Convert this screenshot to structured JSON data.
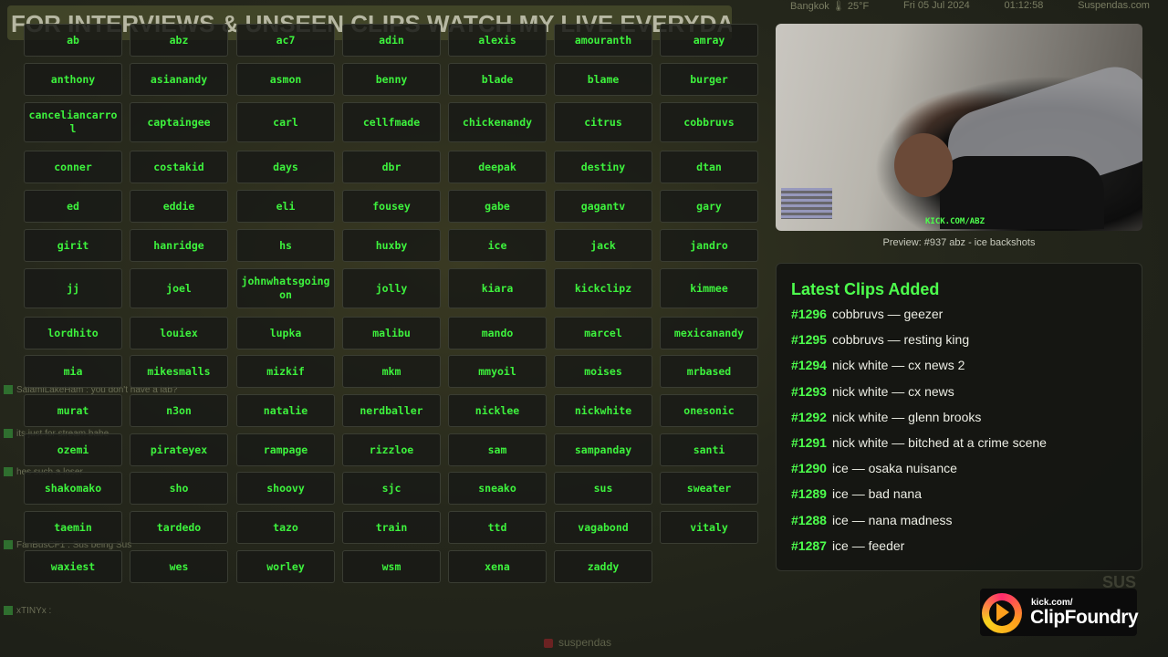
{
  "background": {
    "banner_text": "FOR INTERVIEWS & UNSEEN CLIPS WATCH MY LIVE EVERYDAY",
    "location_text": "Bangkok 🌡 25°F",
    "date_text": "Fri 05 Jul 2024",
    "time_text": "01:12:58",
    "site_text": "Suspendas.com",
    "chat_lines": [
      "SalamiLakeHam : you don't have a lab?",
      "its just for stream babe",
      "hes such a loser",
      "FanBusCF1 : Sus being Sus",
      "xTINYx :"
    ],
    "bottom_text": "suspendas",
    "corner_text": "SUS"
  },
  "buttons": [
    "ab",
    "abz",
    "ac7",
    "adin",
    "alexis",
    "amouranth",
    "amray",
    "anthony",
    "asianandy",
    "asmon",
    "benny",
    "blade",
    "blame",
    "burger",
    "canceliancarrol",
    "captaingee",
    "carl",
    "cellfmade",
    "chickenandy",
    "citrus",
    "cobbruvs",
    "conner",
    "costakid",
    "days",
    "dbr",
    "deepak",
    "destiny",
    "dtan",
    "ed",
    "eddie",
    "eli",
    "fousey",
    "gabe",
    "gagantv",
    "gary",
    "girit",
    "hanridge",
    "hs",
    "huxby",
    "ice",
    "jack",
    "jandro",
    "jj",
    "joel",
    "johnwhatsgoingon",
    "jolly",
    "kiara",
    "kickclipz",
    "kimmee",
    "lordhito",
    "louiex",
    "lupka",
    "malibu",
    "mando",
    "marcel",
    "mexicanandy",
    "mia",
    "mikesmalls",
    "mizkif",
    "mkm",
    "mmyoil",
    "moises",
    "mrbased",
    "murat",
    "n3on",
    "natalie",
    "nerdballer",
    "nicklee",
    "nickwhite",
    "onesonic",
    "ozemi",
    "pirateyex",
    "rampage",
    "rizzloe",
    "sam",
    "sampanday",
    "santi",
    "shakomako",
    "sho",
    "shoovy",
    "sjc",
    "sneako",
    "sus",
    "sweater",
    "taemin",
    "tardedo",
    "tazo",
    "train",
    "ttd",
    "vagabond",
    "vitaly",
    "waxiest",
    "wes",
    "worley",
    "wsm",
    "xena",
    "zaddy"
  ],
  "preview": {
    "watermark": "KICK.COM/ABZ",
    "caption": "Preview: #937 abz - ice backshots"
  },
  "latest": {
    "title": "Latest Clips Added",
    "clips": [
      {
        "num": "#1296",
        "text": "cobbruvs — geezer"
      },
      {
        "num": "#1295",
        "text": "cobbruvs — resting king"
      },
      {
        "num": "#1294",
        "text": "nick white — cx news 2"
      },
      {
        "num": "#1293",
        "text": "nick white — cx news"
      },
      {
        "num": "#1292",
        "text": "nick white — glenn brooks"
      },
      {
        "num": "#1291",
        "text": "nick white — bitched at a crime scene"
      },
      {
        "num": "#1290",
        "text": "ice — osaka nuisance"
      },
      {
        "num": "#1289",
        "text": "ice — bad nana"
      },
      {
        "num": "#1288",
        "text": "ice — nana madness"
      },
      {
        "num": "#1287",
        "text": "ice — feeder"
      }
    ]
  },
  "logo": {
    "kick_text": "kick.com/",
    "brand_text": "ClipFoundry"
  },
  "colors": {
    "accent_green": "#3df23d",
    "panel_bg": "#141512"
  }
}
